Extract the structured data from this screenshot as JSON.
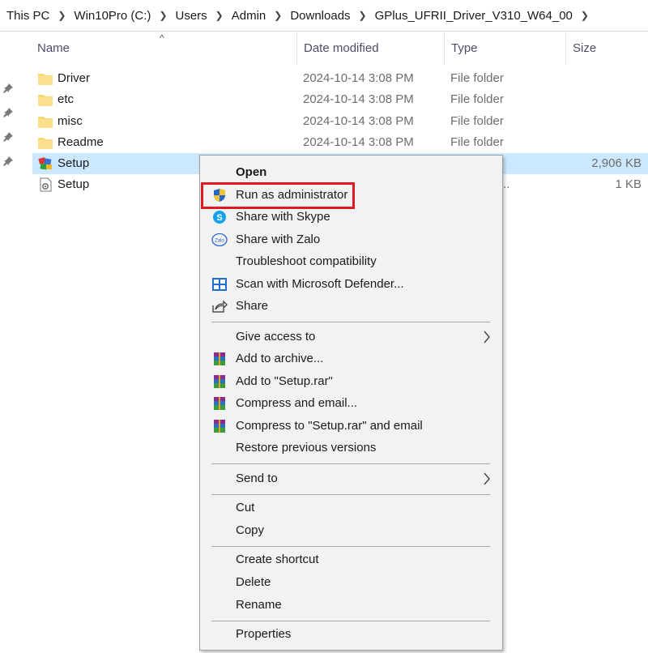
{
  "breadcrumb": [
    "This PC",
    "Win10Pro (C:)",
    "Users",
    "Admin",
    "Downloads",
    "GPlus_UFRII_Driver_V310_W64_00"
  ],
  "columns": {
    "name": "Name",
    "date": "Date modified",
    "type": "Type",
    "size": "Size"
  },
  "files": [
    {
      "name": "Driver",
      "date": "2024-10-14 3:08 PM",
      "type": "File folder",
      "size": "",
      "icon": "folder-icon"
    },
    {
      "name": "etc",
      "date": "2024-10-14 3:08 PM",
      "type": "File folder",
      "size": "",
      "icon": "folder-icon"
    },
    {
      "name": "misc",
      "date": "2024-10-14 3:08 PM",
      "type": "File folder",
      "size": "",
      "icon": "folder-icon"
    },
    {
      "name": "Readme",
      "date": "2024-10-14 3:08 PM",
      "type": "File folder",
      "size": "",
      "icon": "folder-icon"
    },
    {
      "name": "Setup",
      "date": "",
      "type": "on",
      "size": "2,906 KB",
      "icon": "setup-app-icon"
    },
    {
      "name": "Setup",
      "date": "",
      "type": "ation sett...",
      "size": "1 KB",
      "icon": "settings-file-icon"
    }
  ],
  "context_menu": {
    "items": [
      {
        "label": "Open",
        "icon": ""
      },
      {
        "label": "Run as administrator",
        "icon": "uac-shield-icon"
      },
      {
        "label": "Share with Skype",
        "icon": "skype-icon"
      },
      {
        "label": "Share with Zalo",
        "icon": "zalo-icon"
      },
      {
        "label": "Troubleshoot compatibility",
        "icon": ""
      },
      {
        "label": "Scan with Microsoft Defender...",
        "icon": "defender-icon"
      },
      {
        "label": "Share",
        "icon": "share-icon"
      },
      {
        "label": "Give access to",
        "icon": ""
      },
      {
        "label": "Add to archive...",
        "icon": "winrar-icon"
      },
      {
        "label": "Add to \"Setup.rar\"",
        "icon": "winrar-icon"
      },
      {
        "label": "Compress and email...",
        "icon": "winrar-icon"
      },
      {
        "label": "Compress to \"Setup.rar\" and email",
        "icon": "winrar-icon"
      },
      {
        "label": "Restore previous versions",
        "icon": ""
      },
      {
        "label": "Send to",
        "icon": ""
      },
      {
        "label": "Cut",
        "icon": ""
      },
      {
        "label": "Copy",
        "icon": ""
      },
      {
        "label": "Create shortcut",
        "icon": ""
      },
      {
        "label": "Delete",
        "icon": ""
      },
      {
        "label": "Rename",
        "icon": ""
      },
      {
        "label": "Properties",
        "icon": ""
      }
    ]
  },
  "colors": {
    "selection": "#cce8ff",
    "highlight_box": "#e01a22",
    "menu_bg": "#f2f2f2",
    "folder": "#f8d775"
  }
}
